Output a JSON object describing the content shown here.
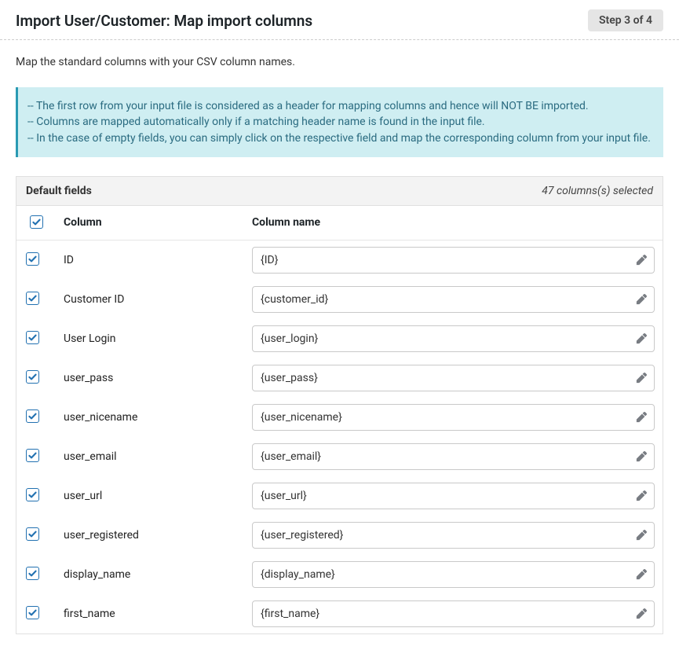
{
  "header": {
    "title": "Import User/Customer: Map import columns",
    "step_label": "Step 3 of 4"
  },
  "intro": "Map the standard columns with your CSV column names.",
  "info": {
    "line1": "-- The first row from your input file is considered as a header for mapping columns and hence will NOT BE imported.",
    "line2": "-- Columns are mapped automatically only if a matching header name is found in the input file.",
    "line3": "-- In the case of empty fields, you can simply click on the respective field and map the corresponding column from your input file."
  },
  "section": {
    "title": "Default fields",
    "selected_label": "47 columns(s) selected"
  },
  "table": {
    "col_header": "Column",
    "colname_header": "Column name",
    "rows": [
      {
        "label": "ID",
        "value": "{ID}"
      },
      {
        "label": "Customer ID",
        "value": "{customer_id}"
      },
      {
        "label": "User Login",
        "value": "{user_login}"
      },
      {
        "label": "user_pass",
        "value": "{user_pass}"
      },
      {
        "label": "user_nicename",
        "value": "{user_nicename}"
      },
      {
        "label": "user_email",
        "value": "{user_email}"
      },
      {
        "label": "user_url",
        "value": "{user_url}"
      },
      {
        "label": "user_registered",
        "value": "{user_registered}"
      },
      {
        "label": "display_name",
        "value": "{display_name}"
      },
      {
        "label": "first_name",
        "value": "{first_name}"
      }
    ]
  }
}
